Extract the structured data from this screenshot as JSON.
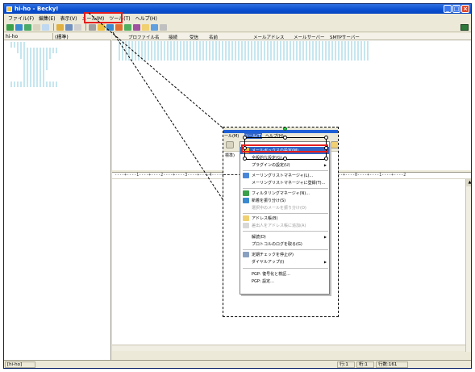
{
  "window": {
    "title": "hi-ho - Becky!"
  },
  "menu": [
    "ファイル(F)",
    "編集(E)",
    "表示(V)",
    "メール(M)",
    "ツール(T)",
    "ヘルプ(H)"
  ],
  "folder_pane": {
    "account": "hi-ho",
    "mode": "(標準)"
  },
  "list_headers": [
    "プロファイル名",
    "接続",
    "受信",
    "名前",
    "メールアドレス",
    "メールサーバー",
    "SMTPサーバー"
  ],
  "ruler": "----+----1----+----2----+----3----+----4----+----5----+----6----+----7----+----8----+----9----+----0----+----1----+----2",
  "status": {
    "left": "[hi-ho]",
    "line": "行:1",
    "col": "桁:1",
    "lines": "行数:161"
  },
  "callout": {
    "menu_fragments": [
      "ール(M)",
      "ツール(T)",
      "ヘルプ(H)"
    ],
    "left_fragments": [
      "標準)"
    ],
    "menu_items": [
      {
        "label": "メールボックスの設定(M)...",
        "state": "selected"
      },
      {
        "label": "全般的な設定(G)...",
        "state": "normal"
      },
      {
        "label": "プラグインの設定(U)",
        "state": "normal",
        "submenu": true
      },
      {
        "label": "メーリングリストマネージャ(L)...",
        "state": "normal"
      },
      {
        "label": "メーリングリストマネージャに登録(T)...",
        "state": "normal"
      },
      {
        "label": "フィルタリングマネージャ(N)...",
        "state": "normal"
      },
      {
        "label": "新着を振り分け(S)",
        "state": "normal"
      },
      {
        "label": "選択中のメールを振り分け(O)",
        "state": "disabled"
      },
      {
        "label": "アドレス帳(B)",
        "state": "normal"
      },
      {
        "label": "差出人をアドレス帳に追加(A)",
        "state": "disabled"
      },
      {
        "label": "解読(D)",
        "state": "normal",
        "submenu": true
      },
      {
        "label": "プロトコルのログを取る(G)",
        "state": "normal"
      },
      {
        "label": "定期チェックを停止(P)",
        "state": "normal"
      },
      {
        "label": "ダイヤルアップ(I)",
        "state": "normal",
        "submenu": true
      },
      {
        "label": "PGP: 復号化と検証...",
        "state": "normal"
      },
      {
        "label": "PGP: 設定...",
        "state": "normal"
      }
    ]
  },
  "colors": {
    "highlight_red": "#e51d1d",
    "selection_blue": "#3163c5",
    "title_blue": "#0a4fd0"
  }
}
